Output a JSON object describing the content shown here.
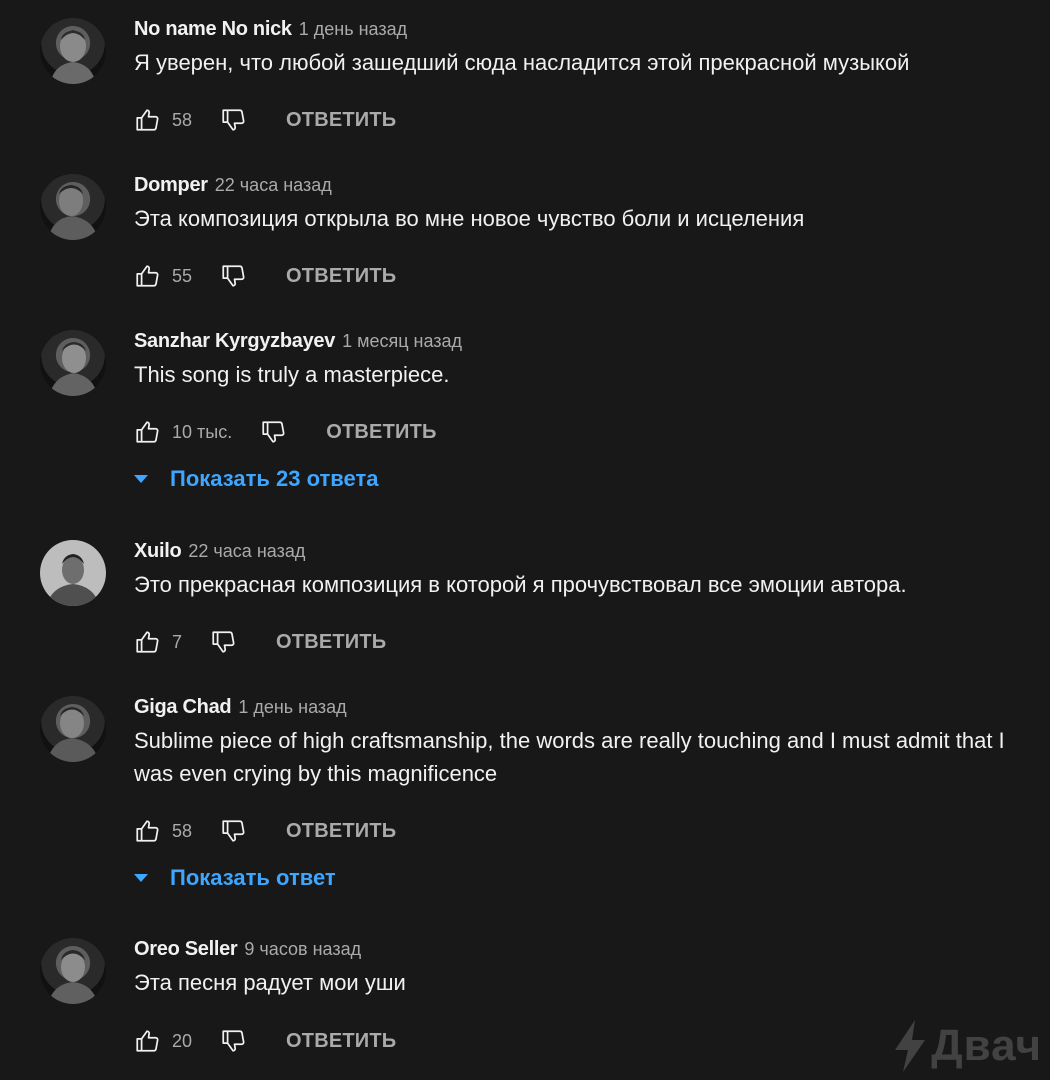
{
  "comments": [
    {
      "author": "No name No nick",
      "time": "1 день назад",
      "text": "Я уверен, что любой зашедший сюда насладится этой прекрасной музыкой",
      "likes": "58",
      "reply_label": "ОТВЕТИТЬ"
    },
    {
      "author": "Domper",
      "time": "22 часа назад",
      "text": "Эта композиция открыла во мне новое чувство боли и исцеления",
      "likes": "55",
      "reply_label": "ОТВЕТИТЬ"
    },
    {
      "author": "Sanzhar Kyrgyzbayev",
      "time": "1 месяц назад",
      "text": "This song is truly a masterpiece.",
      "likes": "10 тыс.",
      "reply_label": "ОТВЕТИТЬ",
      "show_replies": "Показать 23 ответа"
    },
    {
      "author": "Xuilo",
      "time": "22 часа назад",
      "text": "Это прекрасная композиция в которой я прочувствовал все эмоции автора.",
      "likes": "7",
      "reply_label": "ОТВЕТИТЬ"
    },
    {
      "author": "Giga Chad",
      "time": "1 день назад",
      "text": "Sublime piece of high craftsmanship, the words are really touching and I must admit that I was even crying by this magnificence",
      "likes": "58",
      "reply_label": "ОТВЕТИТЬ",
      "show_replies": "Показать ответ"
    },
    {
      "author": "Oreo Seller",
      "time": "9 часов назад",
      "text": "Эта песня радует мои уши",
      "likes": "20",
      "reply_label": "ОТВЕТИТЬ"
    }
  ],
  "watermark": {
    "text": "Двач",
    "icon": "lightning-bolt-icon"
  },
  "icons": {
    "like": "thumbs-up-icon",
    "dislike": "thumbs-down-icon",
    "expand": "caret-down-icon"
  },
  "colors": {
    "background": "#181818",
    "text": "#f1f1f1",
    "secondary": "#aaaaaa",
    "link": "#3ea6ff"
  }
}
